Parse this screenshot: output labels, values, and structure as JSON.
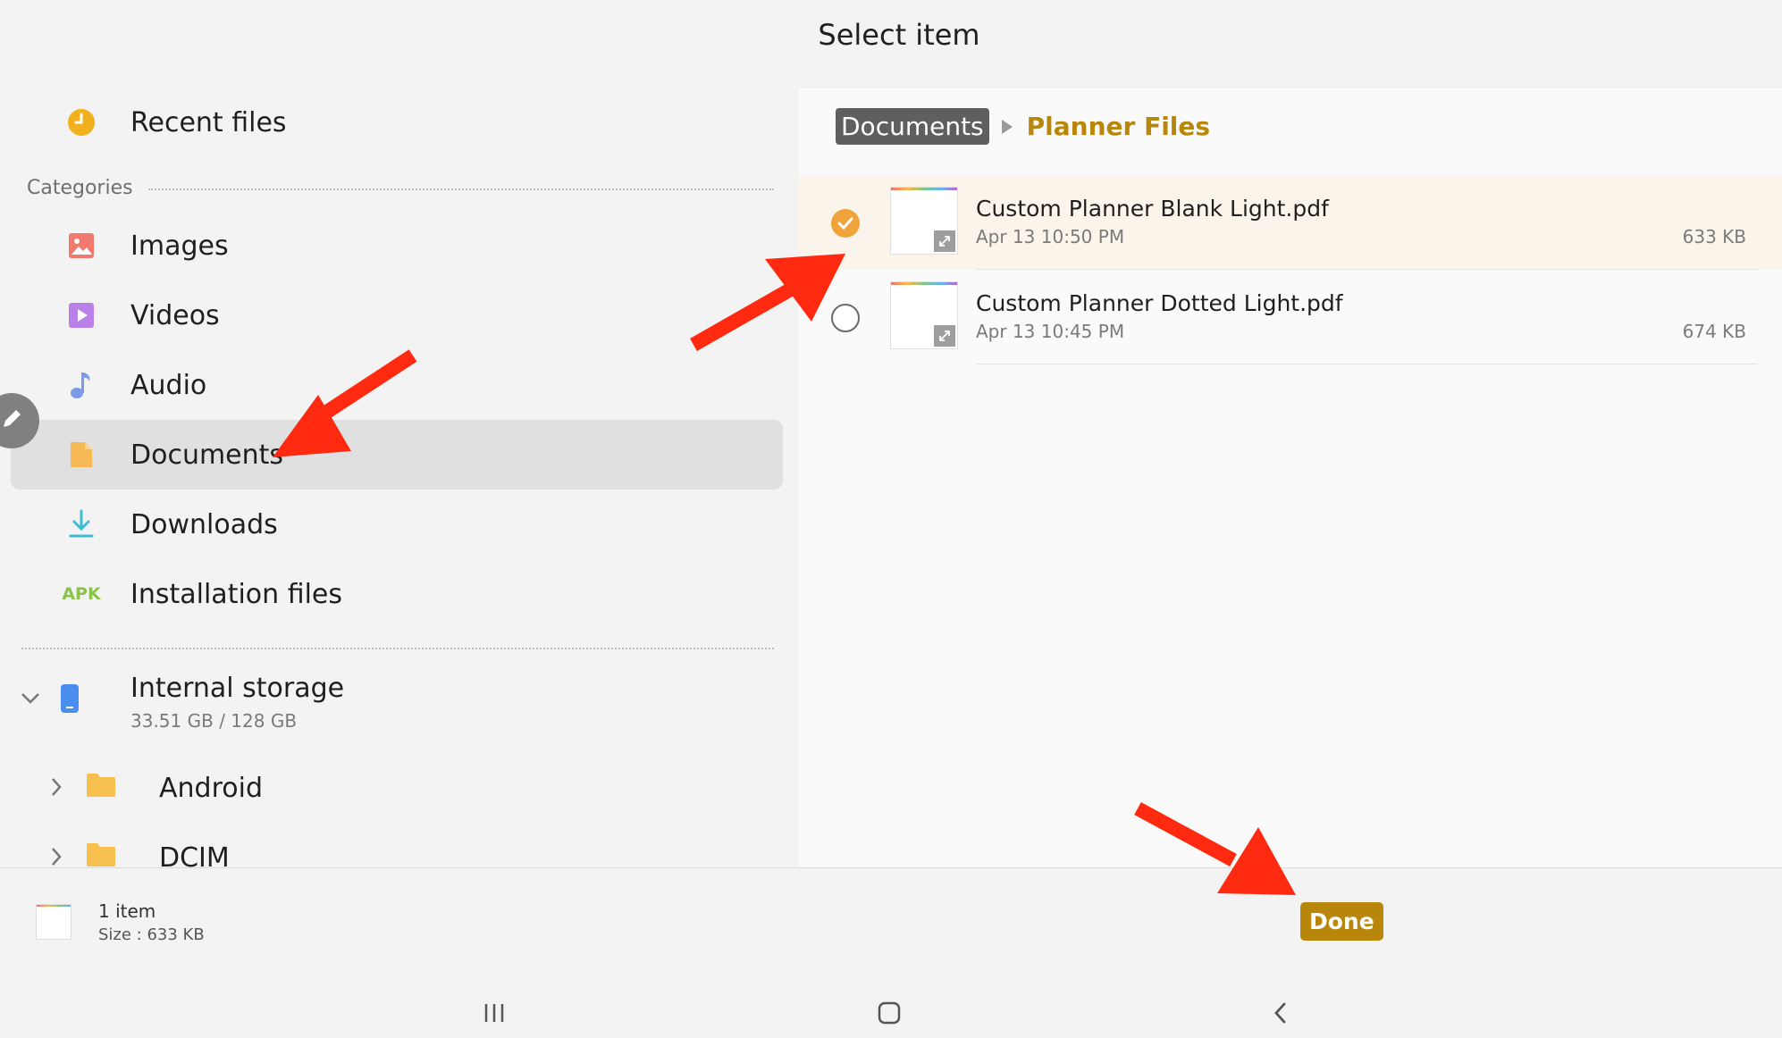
{
  "header": {
    "title": "Select item"
  },
  "sidebar": {
    "recent_label": "Recent files",
    "categories_label": "Categories",
    "items": [
      {
        "label": "Images",
        "icon": "image-icon"
      },
      {
        "label": "Videos",
        "icon": "video-icon"
      },
      {
        "label": "Audio",
        "icon": "music-note-icon"
      },
      {
        "label": "Documents",
        "icon": "document-icon"
      },
      {
        "label": "Downloads",
        "icon": "download-icon"
      },
      {
        "label": "Installation files",
        "icon": "apk-icon",
        "icon_text": "APK"
      }
    ],
    "active_item": "Documents",
    "storage": {
      "title": "Internal storage",
      "usage": "33.51 GB / 128 GB"
    },
    "folders": [
      "Android",
      "DCIM"
    ]
  },
  "breadcrumb": {
    "root": "Documents",
    "current": "Planner Files"
  },
  "files": [
    {
      "name": "Custom Planner Blank Light.pdf",
      "date": "Apr 13 10:50 PM",
      "size": "633 KB",
      "selected": true
    },
    {
      "name": "Custom Planner Dotted Light.pdf",
      "date": "Apr 13 10:45 PM",
      "size": "674 KB",
      "selected": false
    }
  ],
  "selection": {
    "count": "1 item",
    "size": "Size : 633 KB"
  },
  "actions": {
    "done_label": "Done"
  },
  "colors": {
    "accent": "#b8860b",
    "check": "#f0a33a",
    "annotation_arrow": "#ff2a10"
  }
}
